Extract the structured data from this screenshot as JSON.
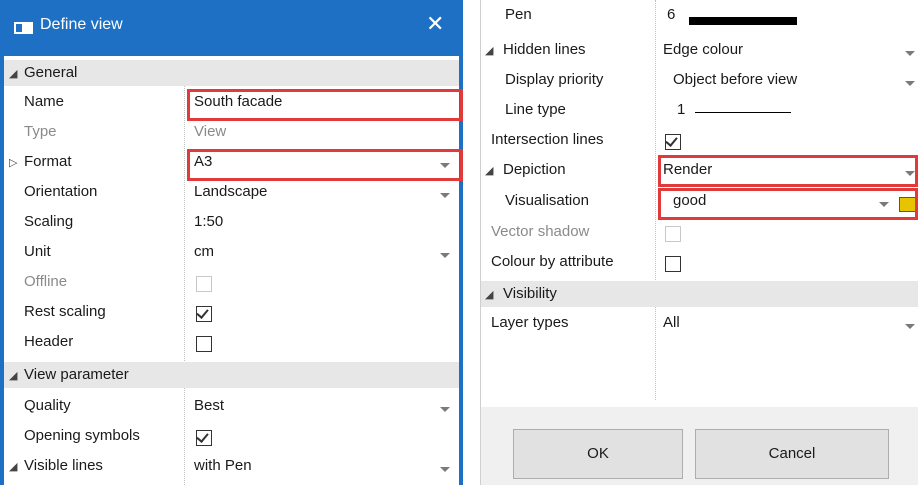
{
  "window": {
    "title": "Define view",
    "close": "✕"
  },
  "left": {
    "general": {
      "header": "General",
      "rows": {
        "name": {
          "label": "Name",
          "value": "South facade"
        },
        "type": {
          "label": "Type",
          "value": "View"
        },
        "format": {
          "label": "Format",
          "value": "A3"
        },
        "orientation": {
          "label": "Orientation",
          "value": "Landscape"
        },
        "scaling": {
          "label": "Scaling",
          "value": "1:50"
        },
        "unit": {
          "label": "Unit",
          "value": "cm"
        },
        "offline": {
          "label": "Offline",
          "checked": false,
          "disabled": true
        },
        "rest_scaling": {
          "label": "Rest scaling",
          "checked": true
        },
        "header": {
          "label": "Header",
          "checked": false
        }
      }
    },
    "view_parameter": {
      "header": "View parameter",
      "rows": {
        "quality": {
          "label": "Quality",
          "value": "Best"
        },
        "opening_symbols": {
          "label": "Opening symbols",
          "checked": true
        },
        "visible_lines": {
          "label": "Visible lines",
          "value": "with Pen"
        }
      }
    }
  },
  "right": {
    "rows": {
      "pen": {
        "label": "Pen",
        "value": "6"
      },
      "hidden_lines": {
        "label": "Hidden lines",
        "value": "Edge colour"
      },
      "display_priority": {
        "label": "Display priority",
        "value": "Object before view"
      },
      "line_type": {
        "label": "Line type",
        "value": "1"
      },
      "intersection_lines": {
        "label": "Intersection lines",
        "checked": true
      },
      "depiction": {
        "label": "Depiction",
        "value": "Render"
      },
      "visualisation": {
        "label": "Visualisation",
        "value": "good"
      },
      "vector_shadow": {
        "label": "Vector shadow",
        "checked": false,
        "disabled": true
      },
      "colour_by_attribute": {
        "label": "Colour by attribute",
        "checked": false
      }
    },
    "visibility": {
      "header": "Visibility",
      "layer_types": {
        "label": "Layer types",
        "value": "All"
      }
    },
    "buttons": {
      "ok": "OK",
      "cancel": "Cancel"
    }
  },
  "icons": {
    "expanded": "◢",
    "collapsed": "▷"
  },
  "colors": {
    "title_bar": "#1e70c4",
    "highlight": "#e03a3a",
    "section_bg": "#e7e7e7"
  }
}
